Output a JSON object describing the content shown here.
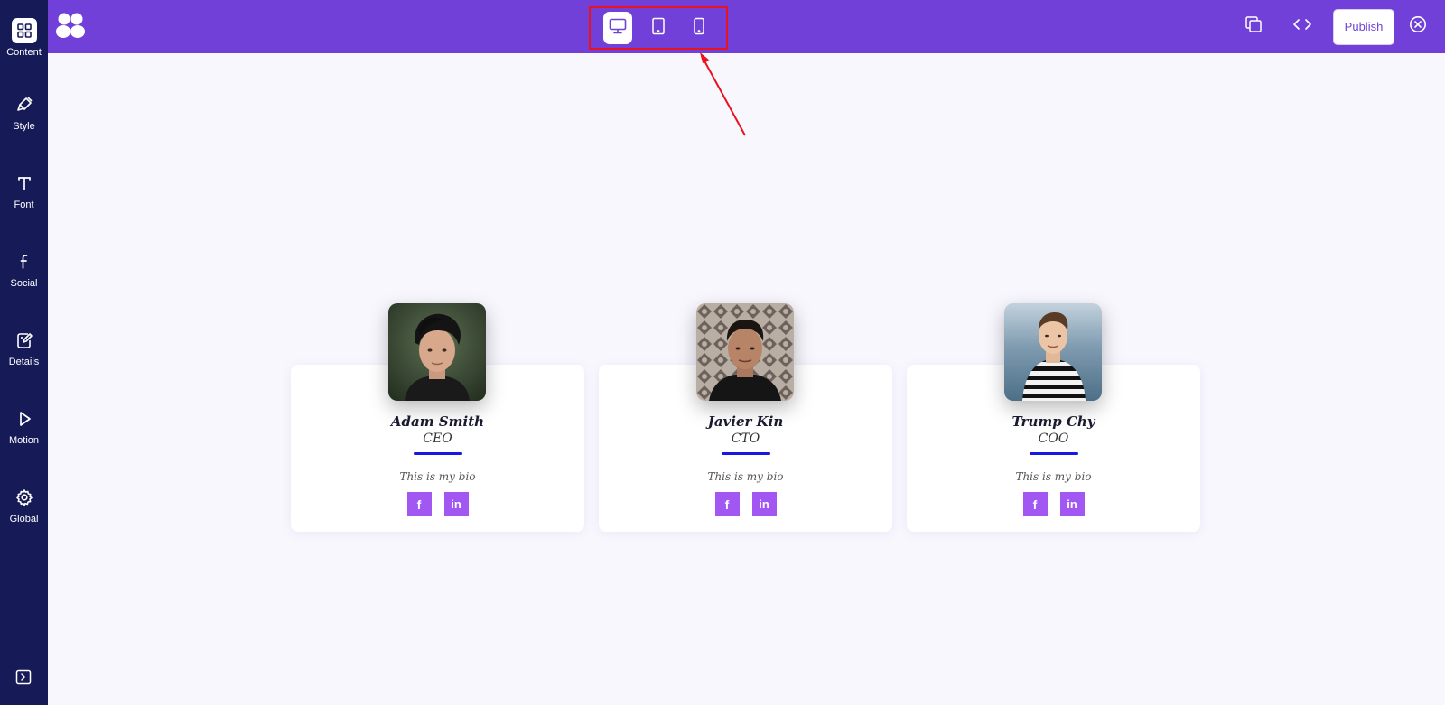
{
  "sidebar": {
    "items": [
      {
        "label": "Content",
        "icon": "grid-icon"
      },
      {
        "label": "Style",
        "icon": "brush-icon"
      },
      {
        "label": "Font",
        "icon": "text-icon"
      },
      {
        "label": "Social",
        "icon": "facebook-icon"
      },
      {
        "label": "Details",
        "icon": "edit-icon"
      },
      {
        "label": "Motion",
        "icon": "play-icon"
      },
      {
        "label": "Global",
        "icon": "gear-icon"
      }
    ],
    "active": "Content",
    "toggle_icon": "expand-panel-icon"
  },
  "topbar": {
    "logo_icon": "app-logo-icon",
    "devices": [
      {
        "icon": "desktop-icon",
        "active": true
      },
      {
        "icon": "tablet-icon",
        "active": false
      },
      {
        "icon": "mobile-icon",
        "active": false
      }
    ],
    "publish_label": "Publish",
    "actions": [
      "copy-icon",
      "code-icon",
      "close-circle-icon"
    ]
  },
  "colors": {
    "topbar": "#7140d8",
    "sidebar": "#161a57",
    "canvas": "#f8f7fe",
    "social_button": "#a257f2",
    "underline": "#1717e6",
    "annotation": "#e8131c"
  },
  "team": [
    {
      "name": "Adam Smith",
      "role": "CEO",
      "bio": "This is my bio",
      "social": {
        "facebook": "f",
        "linkedin": "in"
      }
    },
    {
      "name": "Javier Kin",
      "role": "CTO",
      "bio": "This is my bio",
      "social": {
        "facebook": "f",
        "linkedin": "in"
      }
    },
    {
      "name": "Trump Chy",
      "role": "COO",
      "bio": "This is my bio",
      "social": {
        "facebook": "f",
        "linkedin": "in"
      }
    }
  ]
}
